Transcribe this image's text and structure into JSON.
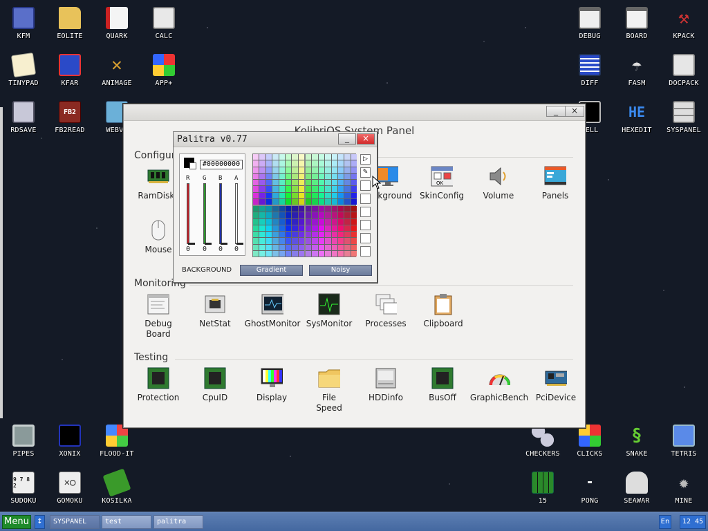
{
  "desktop": {
    "icons_top_left": [
      "KFM",
      "EOLITE",
      "QUARK",
      "CALC",
      "TINYPAD",
      "KFAR",
      "ANIMAGE",
      "APP+",
      "RDSAVE",
      "FB2READ",
      "WEBVI"
    ],
    "icons_top_right": [
      "DEBUG",
      "BOARD",
      "KPACK",
      "DIFF",
      "FASM",
      "DOCPACK",
      "HELL",
      "HEXEDIT",
      "SYSPANEL"
    ],
    "icons_bottom_left": [
      "PIPES",
      "XONIX",
      "FLOOD-IT",
      "SUDOKU",
      "GOMOKU",
      "KOSILKA"
    ],
    "icons_bottom_right": [
      "CHECKERS",
      "CLICKS",
      "SNAKE",
      "TETRIS",
      "15",
      "PONG",
      "SEAWAR",
      "MINE"
    ],
    "icon_badges": {
      "fb2": "FB2",
      "hexedit": "HE",
      "sudoku": "9 7 8 2"
    }
  },
  "system_panel": {
    "title": "KolibriOS System Panel",
    "minimize": "_",
    "close": "×",
    "sections": {
      "configuration": "Configuration",
      "monitoring": "Monitoring",
      "testing": "Testing"
    },
    "configuration_items": [
      "RamDisks",
      "Mouse",
      "Background",
      "SkinConfig",
      "Volume",
      "Panels"
    ],
    "monitoring_items": [
      "Debug\nBoard",
      "NetStat",
      "GhostMonitor",
      "SysMonitor",
      "Processes",
      "Clipboard"
    ],
    "testing_items": [
      "Protection",
      "CpuID",
      "Display",
      "File\nSpeed",
      "HDDinfo",
      "BusOff",
      "GraphicBench",
      "PciDevice"
    ]
  },
  "palitra": {
    "title": "Palitra v0.77",
    "minimize": "_",
    "close": "×",
    "hex_value": "#00000000",
    "channels": [
      {
        "label": "R",
        "value": "0",
        "color": "#c0202a"
      },
      {
        "label": "G",
        "value": "0",
        "color": "#2a9a2a"
      },
      {
        "label": "B",
        "value": "0",
        "color": "#2030a8"
      },
      {
        "label": "A",
        "value": "0",
        "color": "#ffffff"
      }
    ],
    "background_label": "BACKGROUND",
    "gradient_btn": "Gradient",
    "noisy_btn": "Noisy"
  },
  "taskbar": {
    "menu": "Menu",
    "arrow": "↕",
    "tasks": [
      "SYSPANEL",
      "test",
      "palitra"
    ],
    "lang": "En",
    "clock": "12 45"
  }
}
